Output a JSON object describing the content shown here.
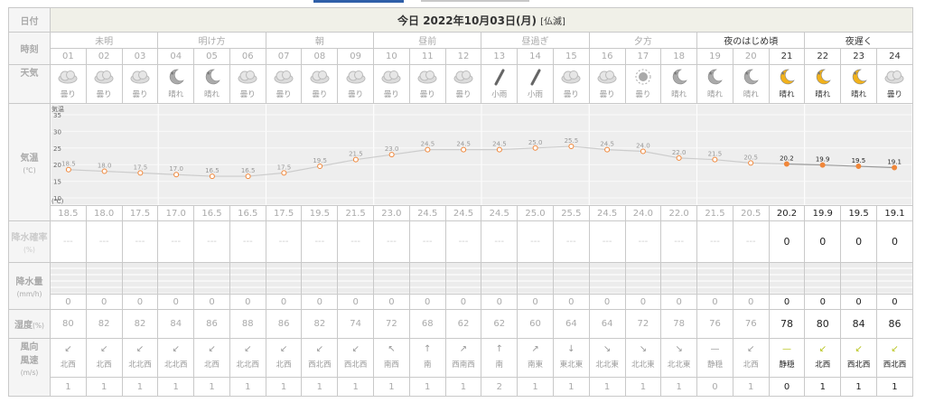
{
  "date_label": "日付",
  "title": "今日 2022年10月03日(月)",
  "rokuyo": "[仏滅]",
  "labels": {
    "time": "時刻",
    "weather": "天気",
    "temp": "気温",
    "temp_unit": "(℃)",
    "precip_prob": "降水確率",
    "precip_prob_unit": "(%)",
    "precip": "降水量",
    "precip_unit": "(mm/h)",
    "humidity": "湿度",
    "humidity_unit": "(%)",
    "wind": "風向\n風速",
    "wind_unit": "(m/s)"
  },
  "periods": [
    "未明",
    "明け方",
    "朝",
    "昼前",
    "昼過ぎ",
    "夕方",
    "夜のはじめ頃",
    "夜遅く"
  ],
  "hours": [
    "01",
    "02",
    "03",
    "04",
    "05",
    "06",
    "07",
    "08",
    "09",
    "10",
    "11",
    "12",
    "13",
    "14",
    "15",
    "16",
    "17",
    "18",
    "19",
    "20",
    "21",
    "22",
    "23",
    "24"
  ],
  "weather": [
    "曇り",
    "曇り",
    "曇り",
    "晴れ",
    "晴れ",
    "曇り",
    "曇り",
    "曇り",
    "曇り",
    "曇り",
    "曇り",
    "曇り",
    "小雨",
    "小雨",
    "曇り",
    "曇り",
    "曇り",
    "晴れ",
    "晴れ",
    "晴れ",
    "晴れ",
    "晴れ",
    "晴れ",
    "曇り"
  ],
  "weather_icons": [
    "cloud-icon",
    "cloud-icon",
    "cloud-icon",
    "moon-icon",
    "moon-icon",
    "cloud-icon",
    "cloud-icon",
    "cloud-icon",
    "cloud-icon",
    "cloud-icon",
    "cloud-icon",
    "cloud-icon",
    "umbrella-icon",
    "umbrella-icon",
    "cloud-icon",
    "cloud-icon",
    "sun-icon",
    "moon-icon",
    "moon-icon",
    "moon-icon",
    "moon-icon",
    "moon-icon",
    "moon-icon",
    "cloud-icon"
  ],
  "temps": [
    "18.5",
    "18.0",
    "17.5",
    "17.0",
    "16.5",
    "16.5",
    "17.5",
    "19.5",
    "21.5",
    "23.0",
    "24.5",
    "24.5",
    "24.5",
    "25.0",
    "25.5",
    "24.5",
    "24.0",
    "22.0",
    "21.5",
    "20.5",
    "20.2",
    "19.9",
    "19.5",
    "19.1"
  ],
  "chart_data": {
    "type": "line",
    "x": [
      "01",
      "02",
      "03",
      "04",
      "05",
      "06",
      "07",
      "08",
      "09",
      "10",
      "11",
      "12",
      "13",
      "14",
      "15",
      "16",
      "17",
      "18",
      "19",
      "20",
      "21",
      "22",
      "23",
      "24"
    ],
    "values": [
      18.5,
      18.0,
      17.5,
      17.0,
      16.5,
      16.5,
      17.5,
      19.5,
      21.5,
      23.0,
      24.5,
      24.5,
      24.5,
      25.0,
      25.5,
      24.5,
      24.0,
      22.0,
      21.5,
      20.5,
      20.2,
      19.9,
      19.5,
      19.1
    ],
    "ylim": [
      10,
      35
    ],
    "yticks": [
      "35",
      "30",
      "25",
      "20",
      "15",
      "10"
    ],
    "ylabel_top": "気温",
    "ylabel_bottom": "(℃)"
  },
  "precip_prob": [
    "---",
    "---",
    "---",
    "---",
    "---",
    "---",
    "---",
    "---",
    "---",
    "---",
    "---",
    "---",
    "---",
    "---",
    "---",
    "---",
    "---",
    "---",
    "---",
    "---",
    "0",
    "0",
    "0",
    "0"
  ],
  "precip": [
    "0",
    "0",
    "0",
    "0",
    "0",
    "0",
    "0",
    "0",
    "0",
    "0",
    "0",
    "0",
    "0",
    "0",
    "0",
    "0",
    "0",
    "0",
    "0",
    "0",
    "0",
    "0",
    "0",
    "0"
  ],
  "humidity": [
    "80",
    "82",
    "82",
    "84",
    "86",
    "88",
    "86",
    "82",
    "74",
    "72",
    "68",
    "62",
    "62",
    "60",
    "64",
    "64",
    "72",
    "78",
    "76",
    "76",
    "78",
    "80",
    "84",
    "86"
  ],
  "wind_arrows": [
    "↙",
    "↙",
    "↙",
    "↙",
    "↙",
    "↙",
    "↙",
    "↙",
    "↙",
    "↖",
    "↑",
    "↗",
    "↑",
    "↗",
    "↓",
    "↘",
    "↘",
    "↘",
    "—",
    "↙",
    "—",
    "↙",
    "↙",
    "↙"
  ],
  "wind_dir": [
    "北西",
    "北西",
    "北北西",
    "北北西",
    "北西",
    "北北西",
    "北西",
    "西北西",
    "西北西",
    "南西",
    "南",
    "西南西",
    "南",
    "南東",
    "東北東",
    "北北東",
    "北北東",
    "北北東",
    "静穏",
    "北西",
    "静穏",
    "北西",
    "西北西",
    "西北西"
  ],
  "wind_speed": [
    "1",
    "1",
    "1",
    "1",
    "1",
    "1",
    "1",
    "1",
    "1",
    "1",
    "1",
    "1",
    "2",
    "1",
    "1",
    "1",
    "1",
    "1",
    "0",
    "1",
    "0",
    "1",
    "1",
    "1"
  ],
  "active_from": 20
}
